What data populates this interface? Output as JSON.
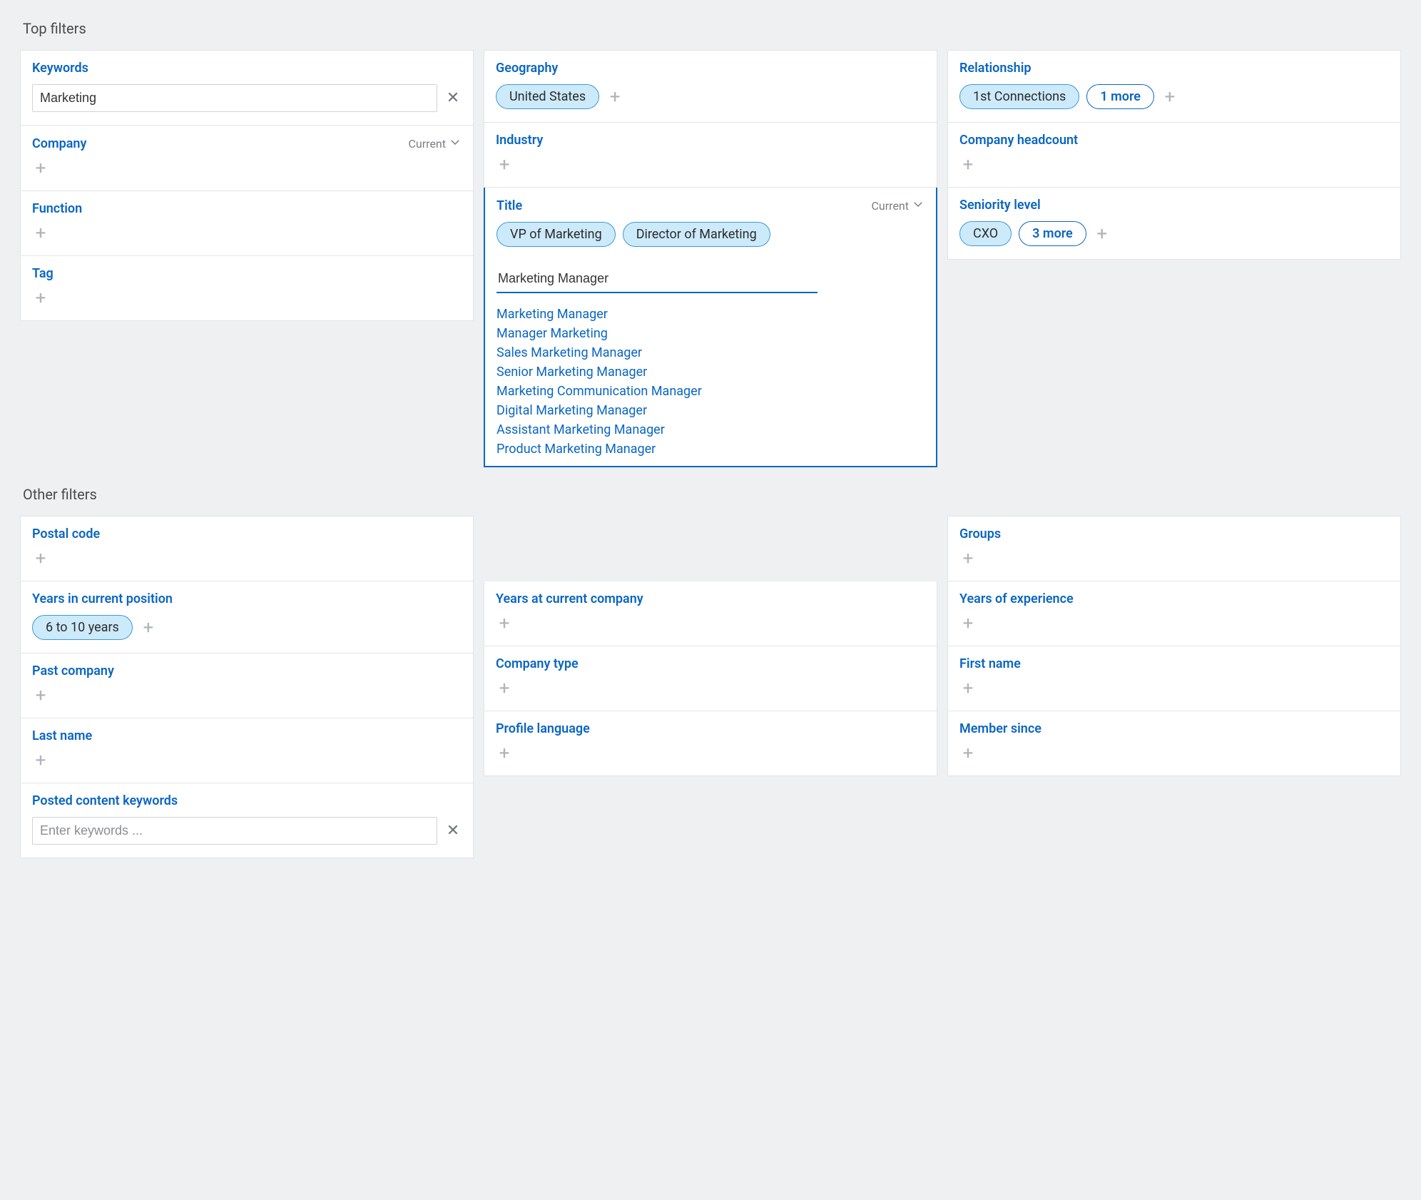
{
  "sections": {
    "top": "Top filters",
    "other": "Other filters"
  },
  "labels": {
    "current": "Current"
  },
  "top_filters": {
    "keywords": {
      "title": "Keywords",
      "value": "Marketing"
    },
    "company": {
      "title": "Company"
    },
    "function": {
      "title": "Function"
    },
    "tag": {
      "title": "Tag"
    },
    "geography": {
      "title": "Geography",
      "chips": [
        "United States"
      ]
    },
    "industry": {
      "title": "Industry"
    },
    "title": {
      "title": "Title",
      "chips": [
        "VP of Marketing",
        "Director of Marketing"
      ],
      "search_value": "Marketing Manager",
      "suggestions": [
        "Marketing Manager",
        "Manager Marketing",
        "Sales Marketing Manager",
        "Senior Marketing Manager",
        "Marketing Communication Manager",
        "Digital Marketing Manager",
        "Assistant Marketing Manager",
        "Product Marketing Manager"
      ]
    },
    "relationship": {
      "title": "Relationship",
      "chips": [
        "1st Connections"
      ],
      "more": "1 more"
    },
    "company_headcount": {
      "title": "Company headcount"
    },
    "seniority": {
      "title": "Seniority level",
      "chips": [
        "CXO"
      ],
      "more": "3 more"
    }
  },
  "other_filters": {
    "postal_code": {
      "title": "Postal code"
    },
    "years_current_position": {
      "title": "Years in current position",
      "chips": [
        "6 to 10 years"
      ]
    },
    "past_company": {
      "title": "Past company"
    },
    "last_name": {
      "title": "Last name"
    },
    "posted_content_keywords": {
      "title": "Posted content keywords",
      "placeholder": "Enter keywords ..."
    },
    "years_at_current_company": {
      "title": "Years at current company"
    },
    "company_type": {
      "title": "Company type"
    },
    "profile_language": {
      "title": "Profile language"
    },
    "groups": {
      "title": "Groups"
    },
    "years_of_experience": {
      "title": "Years of experience"
    },
    "first_name": {
      "title": "First name"
    },
    "member_since": {
      "title": "Member since"
    }
  }
}
